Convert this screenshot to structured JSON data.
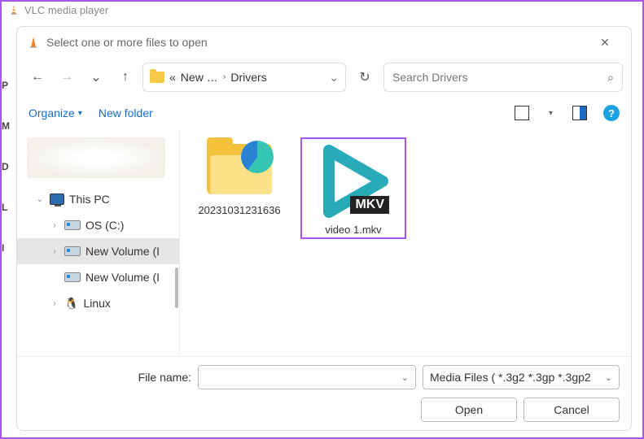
{
  "window": {
    "title": "VLC media player"
  },
  "dialog": {
    "title": "Select one or more files to open"
  },
  "left_edge": [
    "P",
    "M",
    "D",
    "L",
    "I"
  ],
  "breadcrumb": {
    "prefix": "«",
    "part1": "New …",
    "part2": "Drivers"
  },
  "search": {
    "placeholder": "Search Drivers"
  },
  "toolbar2": {
    "organize": "Organize",
    "newfolder": "New folder",
    "help": "?"
  },
  "sidebar": {
    "thispc": "This PC",
    "drives": [
      "OS (C:)",
      "New Volume (I",
      "New Volume (I",
      "Linux"
    ]
  },
  "files": [
    {
      "name": "20231031231636",
      "type": "folder"
    },
    {
      "name": "video 1.mkv",
      "type": "mkv",
      "badge": "MKV",
      "selected": true
    }
  ],
  "bottom": {
    "filename_label": "File name:",
    "filter": "Media Files ( *.3g2 *.3gp *.3gp2",
    "open": "Open",
    "cancel": "Cancel"
  }
}
